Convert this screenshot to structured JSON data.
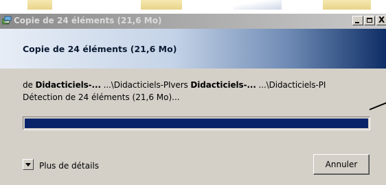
{
  "window": {
    "title": "Copie de 24 éléments (21,6 Mo)",
    "close_glyph": "X"
  },
  "header": {
    "heading": "Copie de 24 éléments (21,6 Mo)"
  },
  "transfer": {
    "prefix": "de ",
    "source_name": "Didacticiels-...",
    "source_path": " ...\\Didacticiels-PI",
    "vers": "vers ",
    "dest_name": "Didacticiels-...",
    "dest_path": " ...\\Didacticiels-PI",
    "status": "Détection de 24 éléments (21,6 Mo)..."
  },
  "progress": {
    "fraction": 1.0
  },
  "details": {
    "label": "Plus de détails"
  },
  "buttons": {
    "cancel": "Annuler"
  },
  "colors": {
    "progress_fill": "#0a246a",
    "header_dark": "#0e2e66"
  },
  "icons": {
    "app": "copy-files-icon",
    "expand": "chevron-down-icon"
  }
}
